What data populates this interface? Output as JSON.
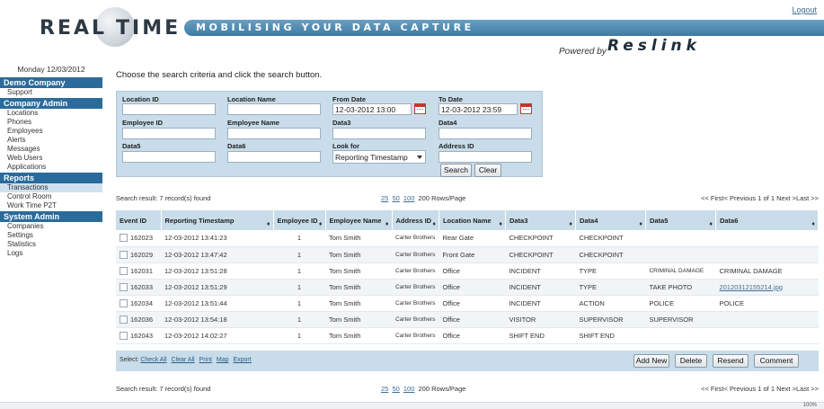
{
  "header": {
    "logo_left": "REAL",
    "logo_right": "TIME",
    "tagline": "MOBILISING YOUR DATA CAPTURE",
    "logout": "Logout",
    "powered_by": "Powered by",
    "brand": "Reslink"
  },
  "sidebar": {
    "date": "Monday 12/03/2012",
    "sections": [
      {
        "title": "Demo Company",
        "items": [
          "Support"
        ]
      },
      {
        "title": "Company Admin",
        "items": [
          "Locations",
          "Phones",
          "Employees",
          "Alerts",
          "Messages",
          "Web Users",
          "Applications"
        ]
      },
      {
        "title": "Reports",
        "items": [
          "Transactions",
          "Control Room",
          "Work Time P2T"
        ]
      },
      {
        "title": "System Admin",
        "items": [
          "Companies",
          "Settings",
          "Statistics",
          "Logs"
        ]
      }
    ]
  },
  "main": {
    "instruction": "Choose the search criteria and click the search button.",
    "search": {
      "location_id": {
        "label": "Location ID",
        "value": ""
      },
      "location_name": {
        "label": "Location Name",
        "value": ""
      },
      "from_date": {
        "label": "From Date",
        "value": "12-03-2012 13:00"
      },
      "to_date": {
        "label": "To Date",
        "value": "12-03-2012 23:59"
      },
      "employee_id": {
        "label": "Employee ID",
        "value": ""
      },
      "employee_name": {
        "label": "Employee Name",
        "value": ""
      },
      "data3": {
        "label": "Data3",
        "value": ""
      },
      "data4": {
        "label": "Data4",
        "value": ""
      },
      "data5": {
        "label": "Data5",
        "value": ""
      },
      "data6": {
        "label": "Data6",
        "value": ""
      },
      "look_for": {
        "label": "Look for",
        "value": "Reporting Timestamp"
      },
      "address_id": {
        "label": "Address ID",
        "value": ""
      },
      "search_button": "Search",
      "clear_button": "Clear"
    },
    "result": {
      "count_text": "Search result: 7 record(s) found",
      "rows_options": [
        "25",
        "50",
        "100"
      ],
      "rows_selected": "200",
      "rows_suffix": "Rows/Page",
      "pager_text": "<< First< Previous 1 of 1 Next >Last >>"
    },
    "table": {
      "columns": [
        "Event ID",
        "Reporting Timestamp",
        "Employee ID",
        "Employee Name",
        "Address ID",
        "Location Name",
        "Data3",
        "Data4",
        "Data5",
        "Data6"
      ],
      "rows": [
        {
          "event_id": "162023",
          "timestamp": "12-03-2012 13:41:23",
          "employee_id": "1",
          "employee_name": "Tom Smith",
          "address": "Carter Brothers",
          "location": "Rear Gate",
          "data3": "CHECKPOINT",
          "data4": "CHECKPOINT",
          "data5": "",
          "data6": ""
        },
        {
          "event_id": "162029",
          "timestamp": "12-03-2012 13:47:42",
          "employee_id": "1",
          "employee_name": "Tom Smith",
          "address": "Carter Brothers",
          "location": "Front Gate",
          "data3": "CHECKPOINT",
          "data4": "CHECKPOINT",
          "data5": "",
          "data6": ""
        },
        {
          "event_id": "162031",
          "timestamp": "12-03-2012 13:51:28",
          "employee_id": "1",
          "employee_name": "Tom Smith",
          "address": "Carter Brothers",
          "location": "Office",
          "data3": "INCIDENT",
          "data4": "TYPE",
          "data5": "CRIMINAL DAMAGE",
          "data6": "CRIMINAL DAMAGE"
        },
        {
          "event_id": "162033",
          "timestamp": "12-03-2012 13:51:29",
          "employee_id": "1",
          "employee_name": "Tom Smith",
          "address": "Carter Brothers",
          "location": "Office",
          "data3": "INCIDENT",
          "data4": "TYPE",
          "data5": "TAKE PHOTO",
          "data6": "20120312155214.jpg"
        },
        {
          "event_id": "162034",
          "timestamp": "12-03-2012 13:51:44",
          "employee_id": "1",
          "employee_name": "Tom Smith",
          "address": "Carter Brothers",
          "location": "Office",
          "data3": "INCIDENT",
          "data4": "ACTION",
          "data5": "POLICE",
          "data6": "POLICE"
        },
        {
          "event_id": "162036",
          "timestamp": "12-03-2012 13:54:18",
          "employee_id": "1",
          "employee_name": "Tom Smith",
          "address": "Carter Brothers",
          "location": "Office",
          "data3": "VISITOR",
          "data4": "SUPERVISOR",
          "data5": "SUPERVISOR",
          "data6": ""
        },
        {
          "event_id": "162043",
          "timestamp": "12-03-2012 14:02:27",
          "employee_id": "1",
          "employee_name": "Tom Smith",
          "address": "Carter Brothers",
          "location": "Office",
          "data3": "SHIFT END",
          "data4": "SHIFT END",
          "data5": "",
          "data6": ""
        }
      ]
    },
    "actions": {
      "select_prefix": "Select:",
      "links": [
        "Check All",
        "Clear All",
        "Print",
        "Map",
        "Export"
      ],
      "add_new": "Add New",
      "delete": "Delete",
      "resend": "Resend",
      "comment": "Comment"
    },
    "footer_result": {
      "count_text": "Search result: 7 record(s) found",
      "pager_text": "<< First< Previous 1 of 1 Next >Last >>"
    }
  },
  "status": {
    "zoom": "100%"
  }
}
